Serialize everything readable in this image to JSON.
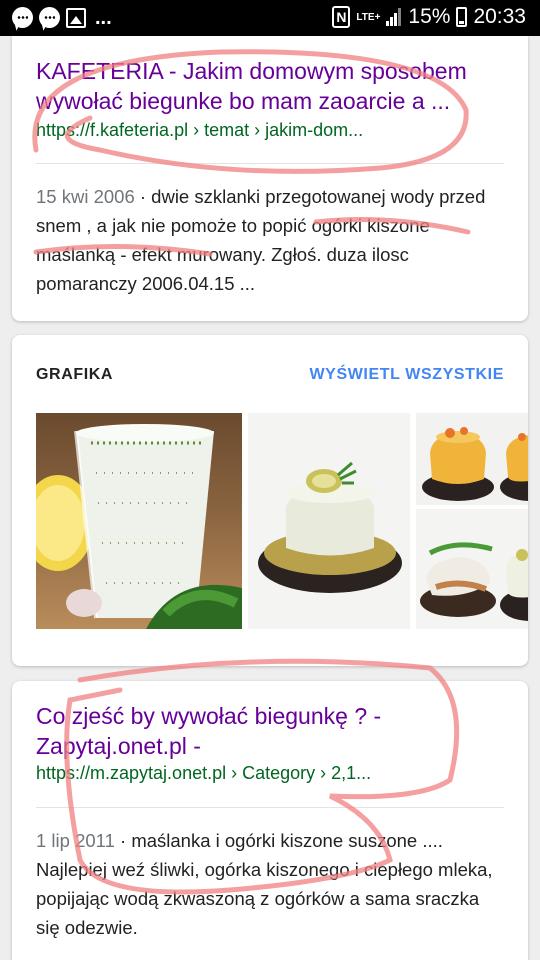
{
  "status_bar": {
    "battery": "15%",
    "time": "20:33",
    "network": "LTE+",
    "nfc_glyph": "N",
    "more": "...",
    "icons": [
      "messenger-icon",
      "messenger-icon",
      "image-icon",
      "nfc-icon",
      "lte-icon",
      "signal-icon",
      "battery-icon"
    ]
  },
  "result1": {
    "title": "KAFETERIA - Jakim domowym sposobem wywołać biegunke bo mam zaoarcie a ...",
    "url": "https://f.kafeteria.pl › temat › jakim-dom...",
    "date": "15 kwi 2006",
    "snippet_line1": " · dwie szklanki przegotowanej wody",
    "snippet_rest": "przed snem , a jak nie pomoże to popić ogórki kiszone maślanką - efekt murowany. Zgłoś. duza ilosc pomaranczy 2006.04.15 ..."
  },
  "images_section": {
    "heading": "GRAFIKA",
    "view_all": "WYŚWIETL WSZYSTKIE",
    "images": [
      "buttermilk-glass-with-dill",
      "jelly-on-rye-bread",
      "aspic-appetizers",
      "herring-appetizer",
      "aspic-on-bread"
    ]
  },
  "result2": {
    "title": "Co zjeść by wywołać biegunkę ? - Zapytaj.onet.pl -",
    "url": "https://m.zapytaj.onet.pl › Category › 2,1...",
    "date": "1 lip 2011",
    "snippet_line1": " · maślanka i ogórki kiszone suszone ....",
    "snippet_rest": "Najlepiej weź śliwki, ogórka kiszonego i ciepłego mleka, popijając wodą zkwaszoną z ogórków a sama sraczka się odezwie."
  },
  "colors": {
    "title": "#660099",
    "url": "#006621",
    "accent": "#4285f4",
    "annotation": "#f08080"
  }
}
